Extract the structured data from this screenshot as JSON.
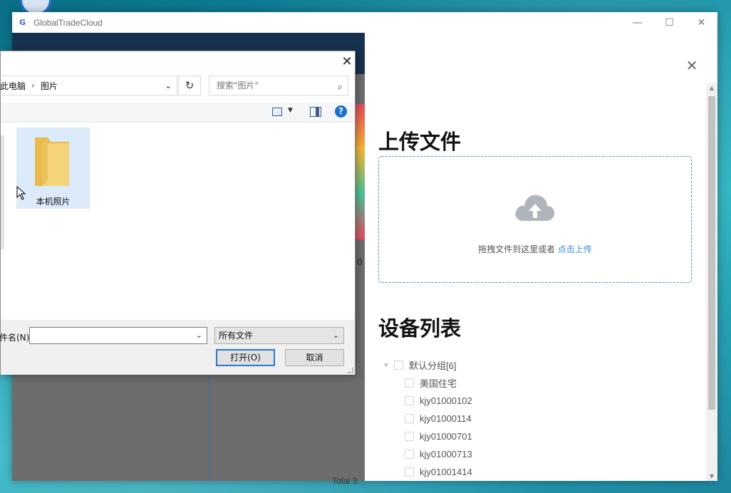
{
  "app": {
    "title": "GlobalTradeCloud",
    "logo_text": "G",
    "minimize": "—",
    "maximize": "☐",
    "close": "✕"
  },
  "left_panel": {
    "partial_label": "0",
    "total": "Total 3"
  },
  "upload": {
    "close": "✕",
    "title": "上传文件",
    "hint": "拖拽文件到这里或者",
    "link": "点击上传"
  },
  "devices": {
    "title": "设备列表",
    "group": {
      "label": "默认分组[6]",
      "caret": "▼"
    },
    "items": [
      {
        "label": "美国住宅"
      },
      {
        "label": "kjy01000102"
      },
      {
        "label": "kjy01000114"
      },
      {
        "label": "kjy01000701"
      },
      {
        "label": "kjy01000713"
      },
      {
        "label": "kjy01001414"
      }
    ]
  },
  "file_dialog": {
    "close": "✕",
    "path": [
      "此电脑",
      "图片"
    ],
    "path_sep": "›",
    "path_dropdown": "⌄",
    "refresh": "↻",
    "search_placeholder": "搜索\"图片\"",
    "search_icon": "⌕",
    "view_caret": "▼",
    "help": "?",
    "folder": {
      "name": "本机照片"
    },
    "filename_label": "件名(N):",
    "filename_value": "",
    "filename_caret": "⌄",
    "filetype": "所有文件",
    "filetype_caret": "⌄",
    "open_button": "打开(O)",
    "cancel_button": "取消"
  },
  "scrollbar": {
    "up": "▲",
    "down": "▼"
  }
}
